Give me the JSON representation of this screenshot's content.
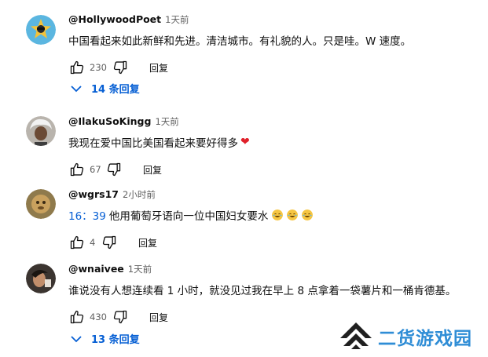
{
  "comments": [
    {
      "author": "@HollywoodPoet",
      "time": "1天前",
      "text": "中国看起来如此新鲜和先进。清洁城市。有礼貌的人。只是哇。W 速度。",
      "likes": "230",
      "reply_label": "回复",
      "replies_label": "14 条回复"
    },
    {
      "author": "@IlakuSoKingg",
      "time": "1天前",
      "text": "我现在爱中国比美国看起来要好得多",
      "likes": "67",
      "reply_label": "回复"
    },
    {
      "author": "@wgrs17",
      "time": "2小时前",
      "timestamp_link": "16：39",
      "text": "他用葡萄牙语向一位中国妇女要水",
      "likes": "4",
      "reply_label": "回复"
    },
    {
      "author": "@wnaivee",
      "time": "1天前",
      "text": "谁说没有人想连续看 1 小时，就没见过我在早上 8 点拿着一袋薯片和一桶肯德基。",
      "likes": "430",
      "reply_label": "回复",
      "replies_label": "13 条回复"
    }
  ],
  "watermark": {
    "text": "二货游戏园"
  },
  "colors": {
    "link": "#065fd4",
    "secondary_text": "#606060",
    "watermark": "#2f8dd6"
  },
  "icons": [
    "like-icon",
    "dislike-icon",
    "chevron-down-icon",
    "heart-emoji",
    "laughing-emoji"
  ]
}
